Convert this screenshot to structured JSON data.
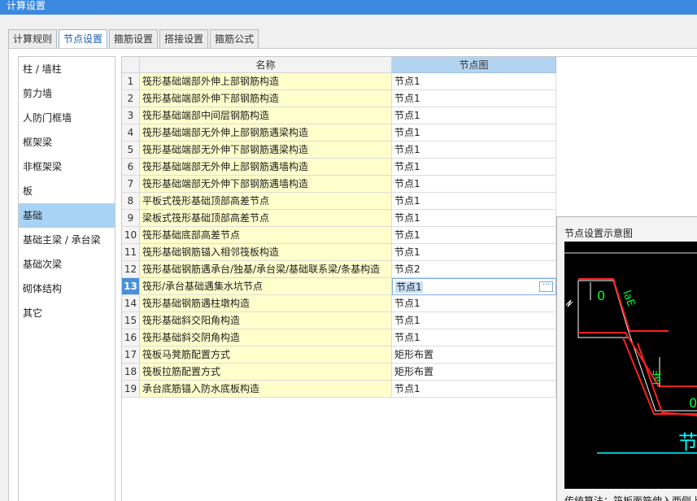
{
  "window": {
    "title": "计算设置"
  },
  "tabs": [
    {
      "label": "计算规则"
    },
    {
      "label": "节点设置"
    },
    {
      "label": "箍筋设置"
    },
    {
      "label": "搭接设置"
    },
    {
      "label": "箍筋公式"
    }
  ],
  "sidebar": {
    "items": [
      {
        "label": "柱 / 墙柱"
      },
      {
        "label": "剪力墙"
      },
      {
        "label": "人防门框墙"
      },
      {
        "label": "框架梁"
      },
      {
        "label": "非框架梁"
      },
      {
        "label": "板"
      },
      {
        "label": "基础"
      },
      {
        "label": "基础主梁 / 承台梁"
      },
      {
        "label": "基础次梁"
      },
      {
        "label": "砌体结构"
      },
      {
        "label": "其它"
      }
    ],
    "selected": "基础"
  },
  "grid": {
    "columns": {
      "name": "名称",
      "node": "节点图"
    },
    "rows": [
      {
        "num": "1",
        "name": "筏形基础端部外伸上部钢筋构造",
        "node": "节点1"
      },
      {
        "num": "2",
        "name": "筏形基础端部外伸下部钢筋构造",
        "node": "节点1"
      },
      {
        "num": "3",
        "name": "筏形基础端部中间层钢筋构造",
        "node": "节点1"
      },
      {
        "num": "4",
        "name": "筏形基础端部无外伸上部钢筋遇梁构造",
        "node": "节点1"
      },
      {
        "num": "5",
        "name": "筏形基础端部无外伸下部钢筋遇梁构造",
        "node": "节点1"
      },
      {
        "num": "6",
        "name": "筏形基础端部无外伸上部钢筋遇墙构造",
        "node": "节点1"
      },
      {
        "num": "7",
        "name": "筏形基础端部无外伸下部钢筋遇墙构造",
        "node": "节点1"
      },
      {
        "num": "8",
        "name": "平板式筏形基础顶部高差节点",
        "node": "节点1"
      },
      {
        "num": "9",
        "name": "梁板式筏形基础顶部高差节点",
        "node": "节点1"
      },
      {
        "num": "10",
        "name": "筏形基础底部高差节点",
        "node": "节点1"
      },
      {
        "num": "11",
        "name": "筏形基础钢筋锚入相邻筏板构造",
        "node": "节点1"
      },
      {
        "num": "12",
        "name": "筏形基础钢筋遇承台/独基/承台梁/基础联系梁/条基构造",
        "node": "节点2"
      },
      {
        "num": "13",
        "name": "筏形/承台基础遇集水坑节点",
        "node": "节点1"
      },
      {
        "num": "14",
        "name": "筏形基础钢筋遇柱墩构造",
        "node": "节点1"
      },
      {
        "num": "15",
        "name": "筏形基础斜交阳角构造",
        "node": "节点1"
      },
      {
        "num": "16",
        "name": "筏形基础斜交阴角构造",
        "node": "节点1"
      },
      {
        "num": "17",
        "name": "筏板马凳筋配置方式",
        "node": "矩形布置"
      },
      {
        "num": "18",
        "name": "筏板拉筋配置方式",
        "node": "矩形布置"
      },
      {
        "num": "19",
        "name": "承台底筋锚入防水底板构造",
        "node": "节点1"
      }
    ],
    "selected_row": "13",
    "ellipsis": "···"
  },
  "preview": {
    "title": "节点设置示意图",
    "labels": {
      "zero_top": "0",
      "lae_top": "laE",
      "lae_side": "laE",
      "zero_bottom": "0",
      "big_char": "节"
    },
    "note": "传统算法：筏板面筋伸入两侧上"
  }
}
